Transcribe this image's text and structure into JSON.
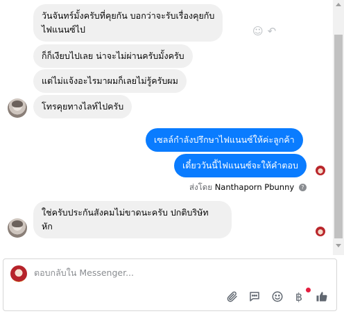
{
  "messages": [
    {
      "direction": "in",
      "lines": [
        "วันจันทร์มั้งครับที่คุยกัน บอกว่าจะรับเรื่องคุยกับ",
        "ไฟแนนซ์ไป"
      ]
    },
    {
      "direction": "in",
      "lines": [
        "ก็ก็เงียบไปเลย น่าจะไม่ผ่านครับมั้งครับ"
      ]
    },
    {
      "direction": "in",
      "lines": [
        "แต่ไม่แจ้งอะไรมาผมก็เลยไม่รู้ครับผม"
      ]
    },
    {
      "direction": "in",
      "lines": [
        "โทรคุยทางไลท์ไปครับ"
      ]
    },
    {
      "direction": "out",
      "lines": [
        "เซลล์กำลังปรึกษาไฟแนนซ์ให้ค่ะลูกค้า"
      ]
    },
    {
      "direction": "out",
      "lines": [
        "เดี๋ยววันนี้ไฟแนนซ์จะให้คำตอบ"
      ]
    },
    {
      "direction": "in",
      "lines": [
        "ใช่ครับประกันสังคมไม่ขาดนะครับ ปกติบริษัท",
        "หัก"
      ]
    }
  ],
  "sent_by": {
    "prefix": "ส่งโดย",
    "name": "Nanthaporn Pbunny",
    "help_icon": "?"
  },
  "composer": {
    "placeholder": "ตอบกลับใน Messenger...",
    "tools": [
      "attachment-icon",
      "chat-bubble-icon",
      "emoji-icon",
      "baht-payment-icon",
      "like-icon"
    ]
  },
  "colors": {
    "outgoing_bubble": "#0a7cff",
    "incoming_bubble": "#f0f0f0",
    "notification_dot": "#e41e3f"
  }
}
